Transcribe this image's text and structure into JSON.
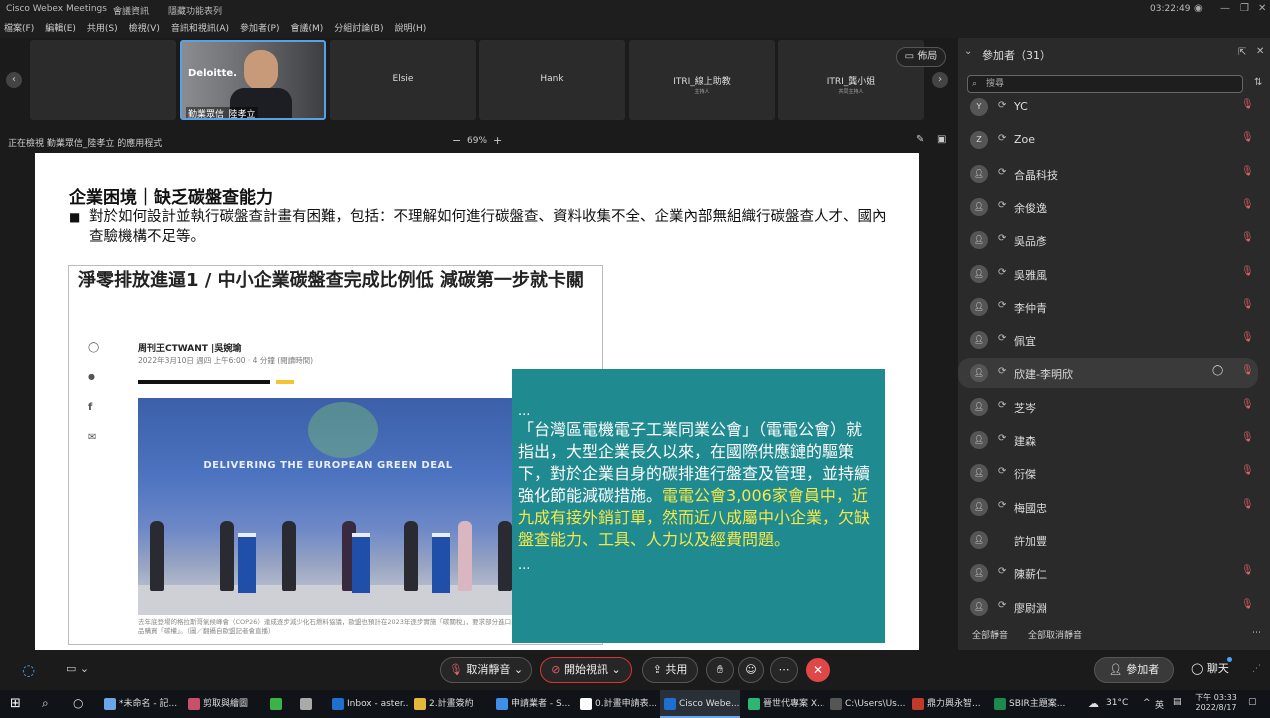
{
  "titlebar": {
    "app": "Cisco Webex Meetings",
    "info": "會議資訊",
    "hidden_menu": "隱藏功能表列",
    "clock": "03:22:49"
  },
  "menu": [
    "檔案(F)",
    "編輯(E)",
    "共用(S)",
    "檢視(V)",
    "音訊和視訊(A)",
    "參加者(P)",
    "會議(M)",
    "分組討論(B)",
    "說明(H)"
  ],
  "videos": [
    {
      "name": "",
      "sub": ""
    },
    {
      "name": "勤業眾信_陸孝立",
      "sub": ""
    },
    {
      "name": "Elsie",
      "sub": ""
    },
    {
      "name": "Hank",
      "sub": ""
    },
    {
      "name": "ITRI_線上助教",
      "sub": "主持人"
    },
    {
      "name": "ITRI_龔小姐",
      "sub": "共同主持人"
    }
  ],
  "layout_label": "佈局",
  "share": {
    "viewing": "正在檢視 勤業眾信_陸孝立 的應用程式",
    "zoom": "69%"
  },
  "slide": {
    "title": "企業困境｜缺乏碳盤查能力",
    "bullet": "對於如何設計並執行碳盤查計畫有困難，包括：不理解如何進行碳盤查、資料收集不全、企業內部無組織行碳盤查人才、國內查驗機構不足等。",
    "article": {
      "headline": "淨零排放進逼1 / 中小企業碳盤查完成比例低 減碳第一步就卡關",
      "author": "周刊王CTWANT |吳婉瑜",
      "date": "2022年3月10日 週四 上午6:00 · 4 分鐘 (閱讀時間)",
      "photo_banner": "DELIVERING THE EUROPEAN GREEN DEAL",
      "caption": "去年底登場的格拉斯哥氣候峰會（COP26）達成逐步減少化石燃料協議，歐盟也預計在2023年逐步實施「碳關稅」，要求部分進口商品購買「碳權」。（圖／翻攝自歐盟記者會直播）"
    },
    "quote": {
      "dots_top": "...",
      "text": "「台灣區電機電子工業同業公會」（電電公會）就指出，大型企業長久以來，在國際供應鏈的驅策下，對於企業自身的碳排進行盤查及管理，並持續強化節能減碳措施。",
      "highlight": "電電公會3,006家會員中，近九成有接外銷訂單，然而近八成屬中小企業，欠缺盤查能力、工具、人力以及經費問題。",
      "dots_bottom": "..."
    }
  },
  "participants": {
    "header": "參加者（31）",
    "search_placeholder": "搜尋",
    "list": [
      {
        "avatar": "Y",
        "name": "YC"
      },
      {
        "avatar": "Z",
        "name": "Zoe"
      },
      {
        "avatar": "",
        "name": "合晶科技"
      },
      {
        "avatar": "",
        "name": "余俊逸"
      },
      {
        "avatar": "",
        "name": "吳品彥"
      },
      {
        "avatar": "",
        "name": "吳雅風"
      },
      {
        "avatar": "",
        "name": "李仲青"
      },
      {
        "avatar": "",
        "name": "佩宜"
      },
      {
        "avatar": "",
        "name": "欣建-李明欣"
      },
      {
        "avatar": "",
        "name": "芝岑"
      },
      {
        "avatar": "",
        "name": "建森"
      },
      {
        "avatar": "",
        "name": "衍傑"
      },
      {
        "avatar": "",
        "name": "梅國忠"
      },
      {
        "avatar": "",
        "name": "許加豐"
      },
      {
        "avatar": "",
        "name": "陳薪仁"
      },
      {
        "avatar": "",
        "name": "廖尉淵"
      }
    ],
    "mute_all": "全部靜音",
    "unmute_all": "全部取消靜音"
  },
  "controls": {
    "unmute": "取消靜音",
    "start_video": "開始視訊",
    "share": "共用",
    "participants": "參加者",
    "chat": "聊天"
  },
  "taskbar": {
    "apps": [
      "*未命名 - 記...",
      "剪取與繪圖",
      "",
      "",
      "Inbox - aster...",
      "2.計畫簽約",
      "申請業者 - S...",
      "0.計畫申請表...",
      "Cisco Webe...",
      "晉世代專案 X...",
      "C:\\Users\\Us...",
      "鼎力興永智...",
      "SBIR主題案..."
    ],
    "weather": "31°C",
    "lang": "英",
    "time": "下午 03:33",
    "date": "2022/8/17"
  },
  "colors": {
    "quote_bg": "#1f8a8f",
    "highlight": "#f5e84a",
    "end_button": "#e04848",
    "mute_icon": "#e0606a"
  }
}
